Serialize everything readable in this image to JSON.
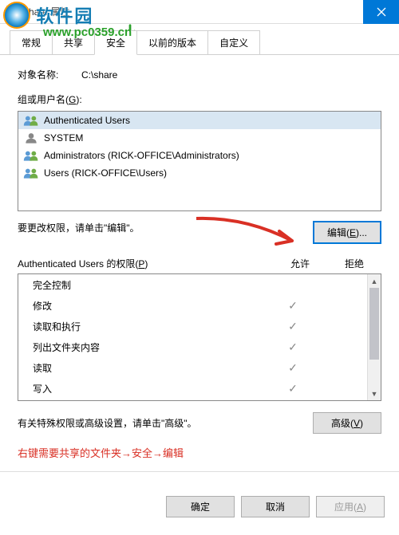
{
  "titlebar": {
    "text": "share 属性"
  },
  "watermark": {
    "text": "软件园",
    "url": "www.pc0359.cn"
  },
  "tabs": [
    "常规",
    "共享",
    "安全",
    "以前的版本",
    "自定义"
  ],
  "active_tab_index": 2,
  "object": {
    "label": "对象名称:",
    "value": "C:\\share"
  },
  "group_label_pre": "组或用户名(",
  "group_label_u": "G",
  "group_label_post": "):",
  "users": [
    {
      "name": "Authenticated Users",
      "selected": true,
      "multi": true
    },
    {
      "name": "SYSTEM",
      "selected": false,
      "multi": false
    },
    {
      "name": "Administrators (RICK-OFFICE\\Administrators)",
      "selected": false,
      "multi": true
    },
    {
      "name": "Users (RICK-OFFICE\\Users)",
      "selected": false,
      "multi": true
    }
  ],
  "edit_hint": "要更改权限，请单击\"编辑\"。",
  "edit_btn_pre": "编辑(",
  "edit_btn_u": "E",
  "edit_btn_post": ")...",
  "perm": {
    "header_pre": "Authenticated Users 的权限(",
    "header_u": "P",
    "header_post": ")",
    "col_allow": "允许",
    "col_deny": "拒绝",
    "rows": [
      {
        "label": "完全控制",
        "allow": false,
        "deny": false
      },
      {
        "label": "修改",
        "allow": true,
        "deny": false
      },
      {
        "label": "读取和执行",
        "allow": true,
        "deny": false
      },
      {
        "label": "列出文件夹内容",
        "allow": true,
        "deny": false
      },
      {
        "label": "读取",
        "allow": true,
        "deny": false
      },
      {
        "label": "写入",
        "allow": true,
        "deny": false
      }
    ]
  },
  "adv_hint": "有关特殊权限或高级设置，请单击\"高级\"。",
  "adv_btn_pre": "高级(",
  "adv_btn_u": "V",
  "adv_btn_post": ")",
  "annotation": "右键需要共享的文件夹→安全→编辑",
  "footer": {
    "ok": "确定",
    "cancel": "取消",
    "apply_pre": "应用(",
    "apply_u": "A",
    "apply_post": ")"
  }
}
